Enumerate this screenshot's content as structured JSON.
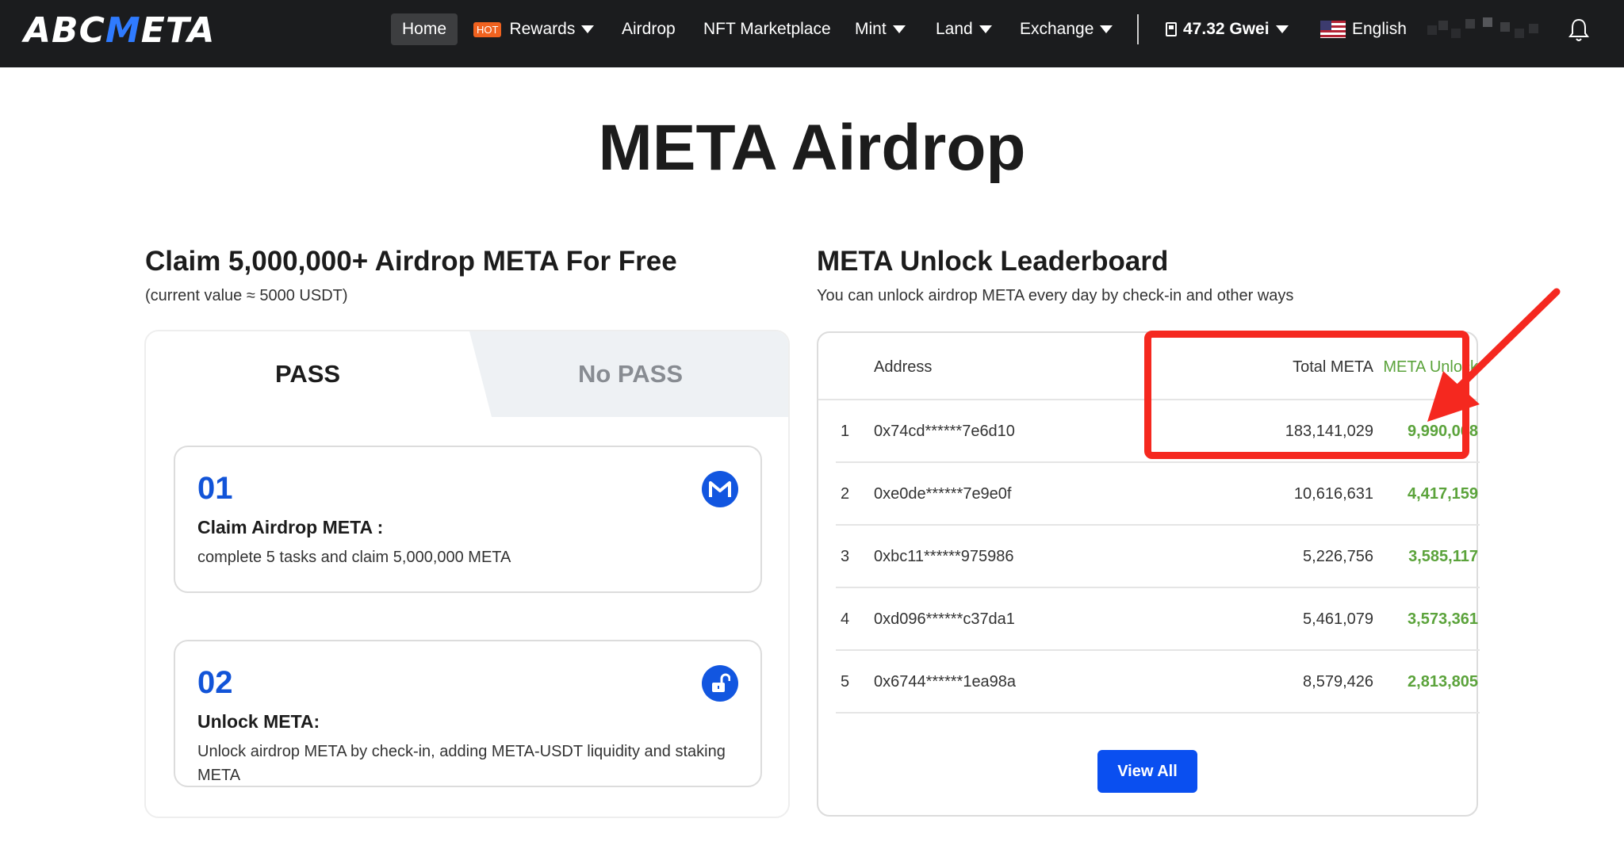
{
  "nav": {
    "logo_prefix": "ABC",
    "logo_m": "M",
    "logo_suffix": "ETA",
    "home": "Home",
    "hot_badge": "HOT",
    "rewards": "Rewards",
    "airdrop": "Airdrop",
    "nft_marketplace": "NFT Marketplace",
    "mint": "Mint",
    "land": "Land",
    "exchange": "Exchange",
    "gas": "47.32 Gwei",
    "language": "English"
  },
  "page": {
    "title": "META Airdrop"
  },
  "claim": {
    "title": "Claim 5,000,000+ Airdrop META For Free",
    "subtitle": "(current value ≈ 5000 USDT)",
    "tab_pass": "PASS",
    "tab_nopass": "No PASS",
    "steps": [
      {
        "num": "01",
        "title": "Claim Airdrop META :",
        "desc": "complete 5 tasks and claim 5,000,000 META",
        "icon": "meta-coin-icon"
      },
      {
        "num": "02",
        "title": "Unlock META:",
        "desc": "Unlock airdrop META by check-in, adding META-USDT liquidity and staking META",
        "icon": "unlock-icon"
      }
    ]
  },
  "leaderboard": {
    "title": "META Unlock Leaderboard",
    "subtitle": "You can unlock airdrop META every day by check-in and other ways",
    "columns": {
      "address": "Address",
      "total": "Total META",
      "unlock": "META Unlock"
    },
    "rows": [
      {
        "rank": "1",
        "address": "0x74cd******7e6d10",
        "total": "183,141,029",
        "unlock": "9,990,068"
      },
      {
        "rank": "2",
        "address": "0xe0de******7e9e0f",
        "total": "10,616,631",
        "unlock": "4,417,159"
      },
      {
        "rank": "3",
        "address": "0xbc11******975986",
        "total": "5,226,756",
        "unlock": "3,585,117"
      },
      {
        "rank": "4",
        "address": "0xd096******c37da1",
        "total": "5,461,079",
        "unlock": "3,573,361"
      },
      {
        "rank": "5",
        "address": "0x6744******1ea98a",
        "total": "8,579,426",
        "unlock": "2,813,805"
      }
    ],
    "view_all": "View All"
  },
  "colors": {
    "nav_bg": "#1b1c1e",
    "accent_blue": "#0a4ff0",
    "unlock_green": "#5ba33b",
    "annotation_red": "#f5281f"
  }
}
